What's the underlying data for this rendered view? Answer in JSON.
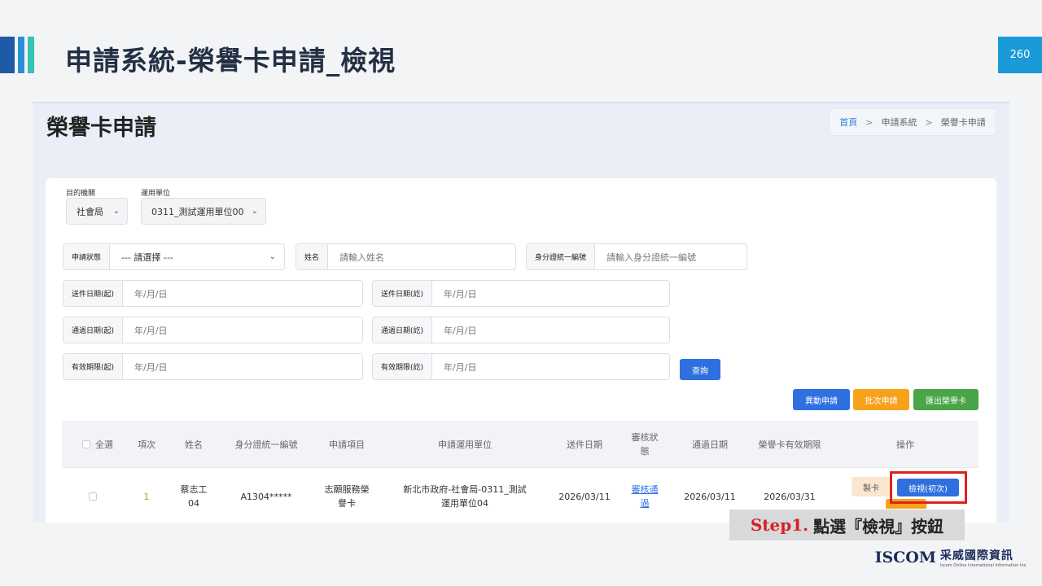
{
  "slide": {
    "title": "申請系統-榮譽卡申請_檢視",
    "page_number": "260"
  },
  "screen": {
    "title": "榮譽卡申請",
    "breadcrumb": [
      "首頁",
      "申請系統",
      "榮譽卡申請"
    ],
    "breadcrumb_sep": ">"
  },
  "filters": {
    "agency_label": "目的機關",
    "agency_value": "社會局",
    "unit_label": "運用單位",
    "unit_value": "0311_測試運用單位00",
    "status_label": "申請狀態",
    "status_value": "--- 請選擇 ---",
    "name_label": "姓名",
    "name_placeholder": "請輸入姓名",
    "id_label": "身分證統一編號",
    "id_placeholder": "請輸入身分證統一編號",
    "send_date_start_label": "送件日期(起)",
    "send_date_end_label": "送件日期(訖)",
    "pass_date_start_label": "通過日期(起)",
    "pass_date_end_label": "通過日期(訖)",
    "valid_start_label": "有效期限(起)",
    "valid_end_label": "有效期限(訖)",
    "date_placeholder": "年/月/日",
    "query_button": "查詢"
  },
  "actions": {
    "change_apply": "異動申請",
    "batch_apply": "批次申請",
    "export": "匯出榮譽卡"
  },
  "table": {
    "headers": [
      "全選",
      "項次",
      "姓名",
      "身分證統一編號",
      "申請項目",
      "申請運用單位",
      "送件日期",
      "審核狀態",
      "通過日期",
      "榮譽卡有效期限",
      "操作"
    ],
    "rows": [
      {
        "index": "1",
        "name": "蔡志工04",
        "id_number": "A1304*****",
        "item": "志願服務榮譽卡",
        "unit": "新北市政府-社會局-0311_測試運用單位04",
        "send_date": "2026/03/11",
        "status": "審核通過",
        "pass_date": "2026/03/11",
        "valid_until": "2026/03/31",
        "card_button": "製卡",
        "view_button": "檢視(初次)"
      }
    ]
  },
  "annotation": {
    "step": "Step1.",
    "text": "點選『檢視』按鈕"
  },
  "logo": {
    "brand": "ISCOM",
    "name_cn": "采威國際資訊",
    "name_en": "Iscom Online International Information Inc."
  },
  "colors": {
    "primary_blue": "#2f6fe0",
    "orange": "#f7a21a",
    "green": "#4aa549",
    "highlight_red": "#e0201c",
    "page_badge": "#1a9ad6"
  }
}
